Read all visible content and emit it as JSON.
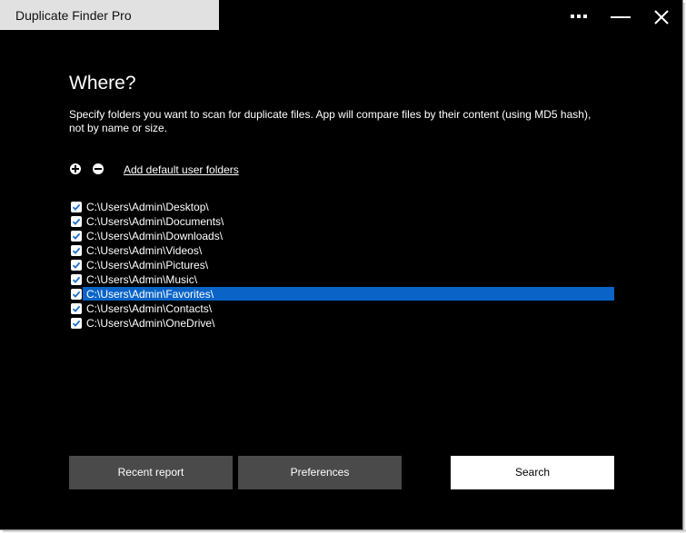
{
  "window": {
    "title": "Duplicate Finder Pro"
  },
  "controls": {
    "menu_icon": "more-dots-icon",
    "minimize_icon": "minimize-icon",
    "close_icon": "close-icon"
  },
  "main": {
    "heading": "Where?",
    "description": "Specify folders you want to scan for duplicate files. App will compare files by their content (using MD5 hash), not by name or size.",
    "add_default_link": "Add default user folders"
  },
  "folders": [
    {
      "path": "C:\\Users\\Admin\\Desktop\\",
      "checked": true,
      "selected": false
    },
    {
      "path": "C:\\Users\\Admin\\Documents\\",
      "checked": true,
      "selected": false
    },
    {
      "path": "C:\\Users\\Admin\\Downloads\\",
      "checked": true,
      "selected": false
    },
    {
      "path": "C:\\Users\\Admin\\Videos\\",
      "checked": true,
      "selected": false
    },
    {
      "path": "C:\\Users\\Admin\\Pictures\\",
      "checked": true,
      "selected": false
    },
    {
      "path": "C:\\Users\\Admin\\Music\\",
      "checked": true,
      "selected": false
    },
    {
      "path": "C:\\Users\\Admin\\Favorites\\",
      "checked": true,
      "selected": true
    },
    {
      "path": "C:\\Users\\Admin\\Contacts\\",
      "checked": true,
      "selected": false
    },
    {
      "path": "C:\\Users\\Admin\\OneDrive\\",
      "checked": true,
      "selected": false
    }
  ],
  "buttons": {
    "recent_report": "Recent report",
    "preferences": "Preferences",
    "search": "Search"
  },
  "colors": {
    "background": "#000000",
    "title_tab": "#e1e1e1",
    "selection": "#0a64c8",
    "checkbox_check": "#1a6fc9",
    "secondary_button": "#4a4a4a",
    "primary_button": "#ffffff"
  }
}
